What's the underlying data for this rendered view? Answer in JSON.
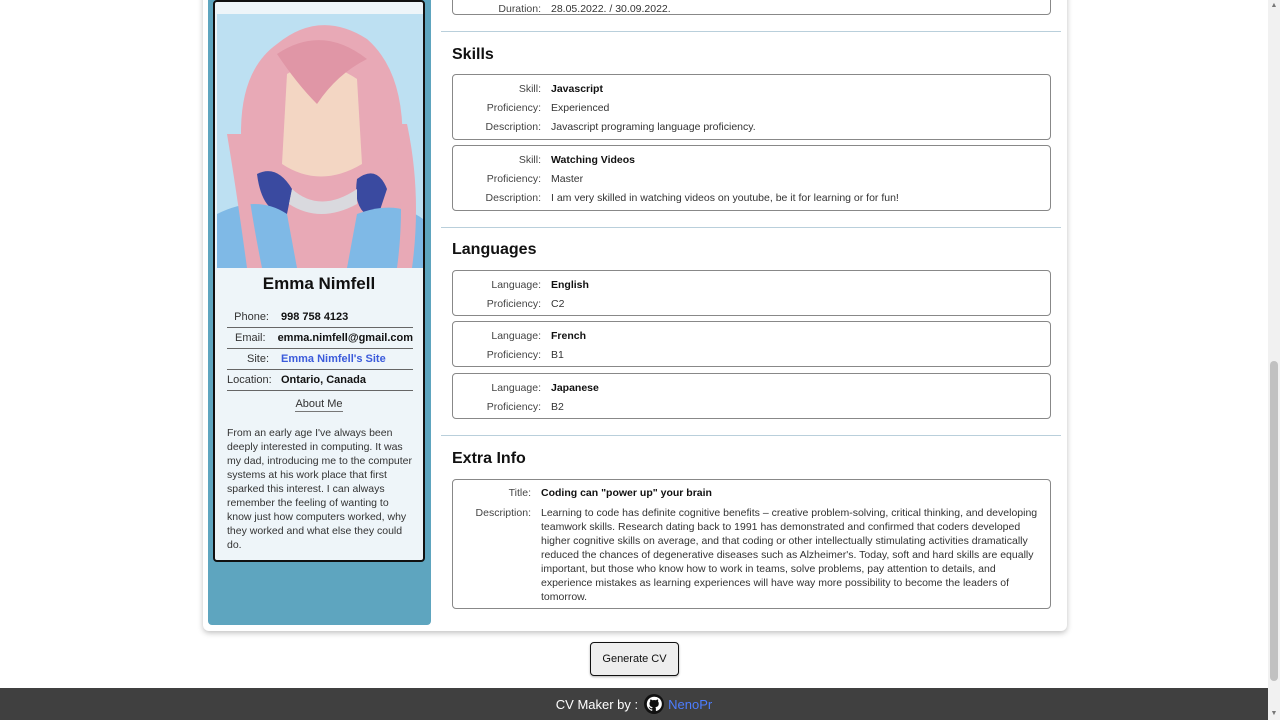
{
  "experience_tail": {
    "label": "Duration:",
    "value": "28.05.2022. / 30.09.2022."
  },
  "profile": {
    "name": "Emma Nimfell",
    "contacts": [
      {
        "label": "Phone:",
        "value": "998 758 4123"
      },
      {
        "label": "Email:",
        "value": "emma.nimfell@gmail.com"
      },
      {
        "label": "Site:",
        "value": "Emma Nimfell's Site"
      },
      {
        "label": "Location:",
        "value": "Ontario, Canada"
      }
    ],
    "about_title": "About Me",
    "about_text": "From an early age I've always been deeply interested in computing. It was my dad, introducing me to the computer systems at his work place that first sparked this interest. I can always remember the feeling of wanting to know just how computers worked, why they worked and what else they could do."
  },
  "skills": {
    "title": "Skills",
    "labels": {
      "skill": "Skill:",
      "proficiency": "Proficiency:",
      "description": "Description:"
    },
    "items": [
      {
        "skill": "Javascript",
        "proficiency": "Experienced",
        "description": "Javascript programing language proficiency."
      },
      {
        "skill": "Watching Videos",
        "proficiency": "Master",
        "description": "I am very skilled in watching videos on youtube, be it for learning or for fun!"
      }
    ]
  },
  "languages": {
    "title": "Languages",
    "labels": {
      "language": "Language:",
      "proficiency": "Proficiency:"
    },
    "items": [
      {
        "language": "English",
        "proficiency": "C2"
      },
      {
        "language": "French",
        "proficiency": "B1"
      },
      {
        "language": "Japanese",
        "proficiency": "B2"
      }
    ]
  },
  "extra": {
    "title": "Extra Info",
    "labels": {
      "title": "Title:",
      "description": "Description:"
    },
    "item_title": "Coding can \"power up\" your brain",
    "description": "Learning to code has definite cognitive benefits – creative problem-solving, critical thinking, and developing teamwork skills. Research dating back to 1991 has demonstrated and confirmed that coders developed higher cognitive skills on average, and that coding or other intellectually stimulating activities dramatically reduced the chances of degenerative diseases such as Alzheimer's. Today, soft and hard skills are equally important, but those who know how to work in teams, solve problems, pay attention to details, and experience mistakes as learning experiences will have way more possibility to become the leaders of tomorrow."
  },
  "generate_button": "Generate CV",
  "footer": {
    "prefix": "CV Maker by :",
    "author": "NenoPr",
    "icon": "github-icon"
  },
  "colors": {
    "sidebar": "#5ea5bf",
    "profile_bg": "#eef5f9",
    "link": "#3b5bdb",
    "footer_bg": "#404040",
    "footer_link": "#4c7dff"
  }
}
